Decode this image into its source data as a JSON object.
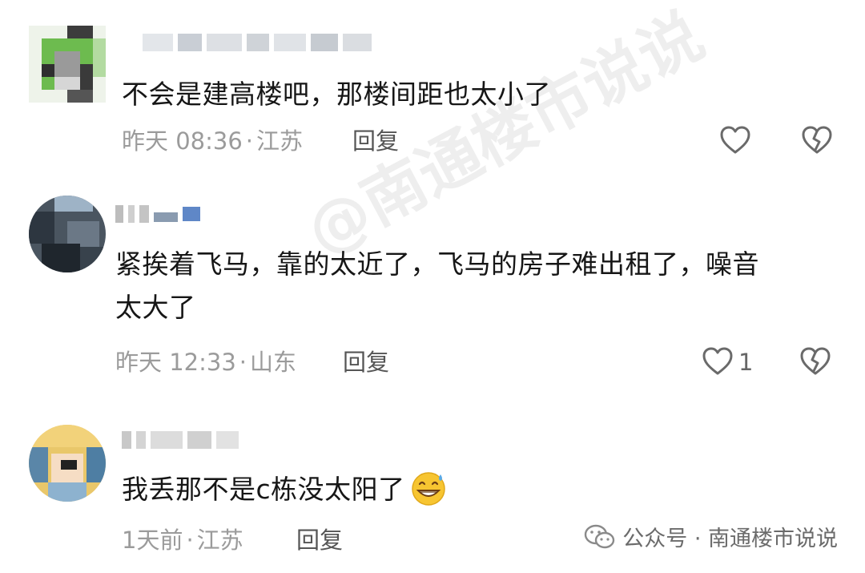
{
  "comments": [
    {
      "content_lines": [
        "不会是建高楼吧，那楼间距也太小了"
      ],
      "time": "昨天 08:36",
      "location": "江苏",
      "reply_label": "回复",
      "like_count": ""
    },
    {
      "content_lines": [
        "紧挨着飞马，靠的太近了，飞马的房子难出租了，噪音",
        "太大了"
      ],
      "time": "昨天 12:33",
      "location": "山东",
      "reply_label": "回复",
      "like_count": "1"
    },
    {
      "content_lines": [
        "我丢那不是c栋没太阳了"
      ],
      "time": "1天前",
      "location": "江苏",
      "reply_label": "回复",
      "like_count": ""
    }
  ],
  "separator": "·",
  "watermark": "@南通楼市说说",
  "footer": {
    "label": "公众号 · 南通楼市说说"
  },
  "icons": {
    "like": "heart-outline-icon",
    "dislike": "broken-heart-icon",
    "emoji": "grinning-sweat-emoji",
    "footer": "wechat-icon"
  },
  "colors": {
    "text": "#161616",
    "meta": "#9b9b9b",
    "reply": "#555555",
    "icon": "#6a6a6a"
  }
}
